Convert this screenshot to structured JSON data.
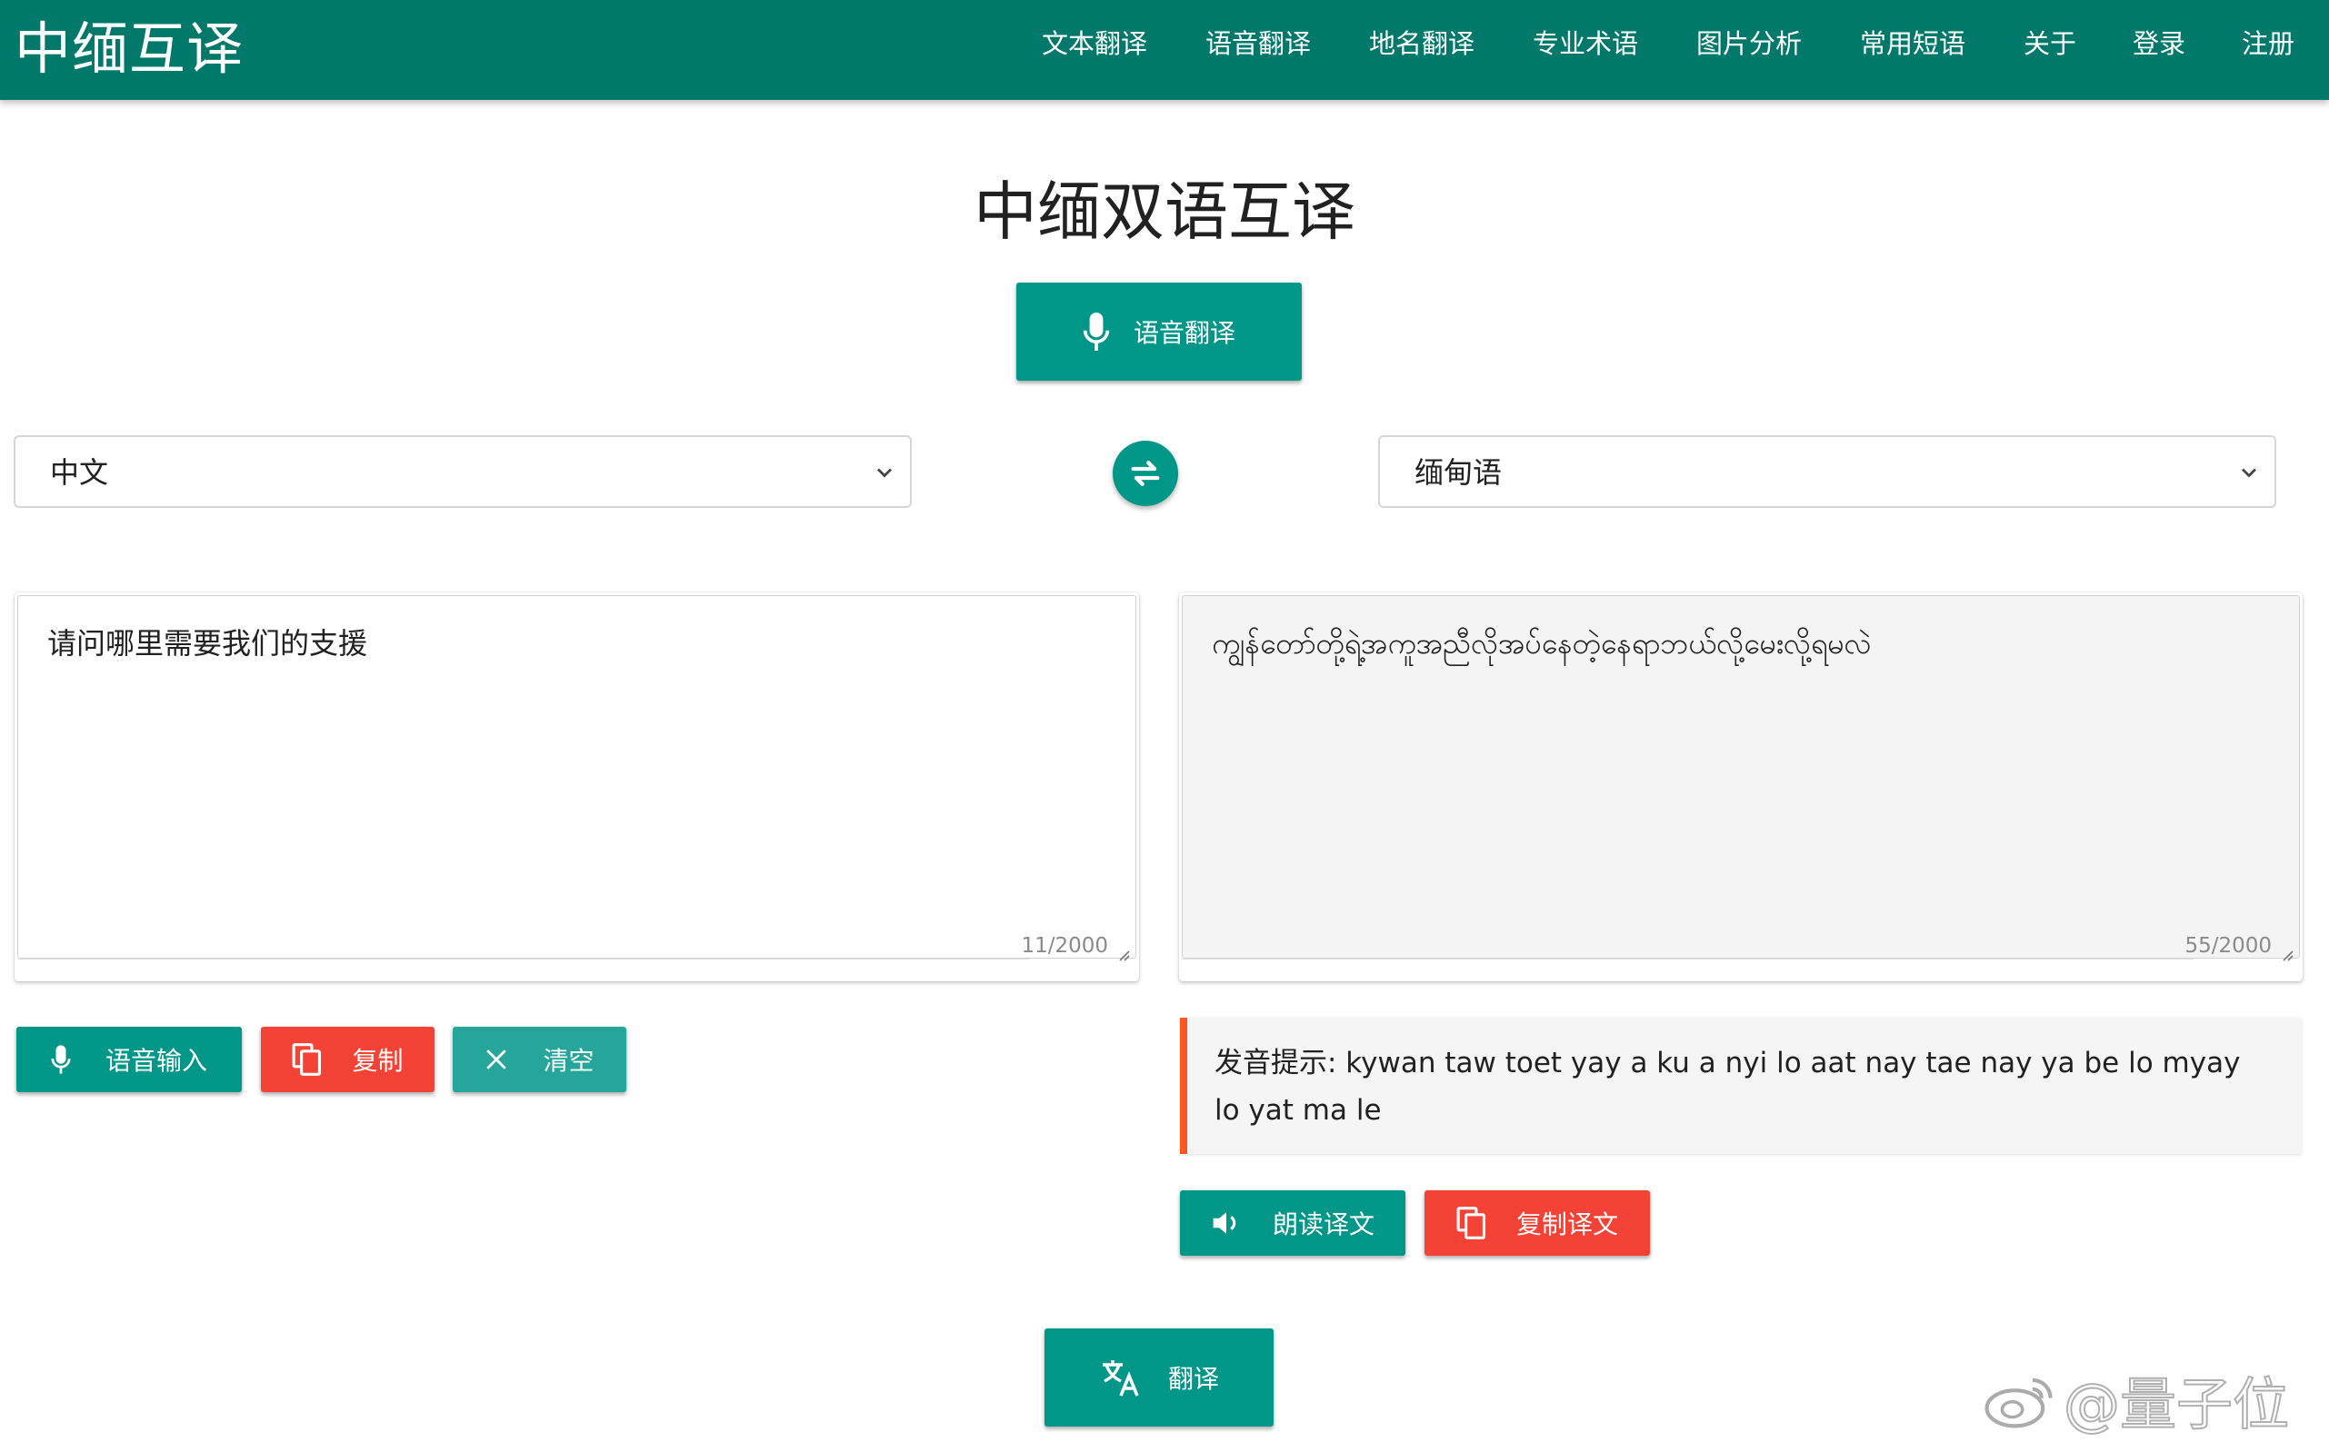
{
  "brand": "中缅互译",
  "nav": {
    "items": [
      "文本翻译",
      "语音翻译",
      "地名翻译",
      "专业术语",
      "图片分析",
      "常用短语",
      "关于",
      "登录",
      "注册"
    ]
  },
  "main": {
    "title": "中缅双语互译",
    "voice_translate_button": "语音翻译",
    "source_language": "中文",
    "target_language": "缅甸语",
    "source_text": "请问哪里需要我们的支援",
    "source_counter": "11/2000",
    "target_text": "ကျွန်တော်တို့ရဲ့အကူအညီလိုအပ်နေတဲ့နေရာဘယ်လို့မေးလို့ရမလဲ",
    "target_counter": "55/2000",
    "source_actions": [
      "语音输入",
      "复制",
      "清空"
    ],
    "pronunciation_hint": "发音提示: kywan taw toet yay a ku a nyi lo aat nay tae nay ya be lo myay lo yat ma le",
    "target_actions": [
      "朗读译文",
      "复制译文"
    ],
    "translate_button": "翻译"
  },
  "watermark": "@量子位",
  "colors": {
    "navbar": "#00796b",
    "primary": "#009688",
    "primary_light": "#26a69a",
    "danger": "#f44336",
    "hint_border": "#ff5722"
  },
  "icons": {
    "mic": "mic-icon",
    "copy": "copy-icon",
    "clear": "close-icon",
    "swap": "swap-icon",
    "speaker": "volume-icon",
    "translate": "translate-icon",
    "dropdown": "chevron-down-icon"
  }
}
